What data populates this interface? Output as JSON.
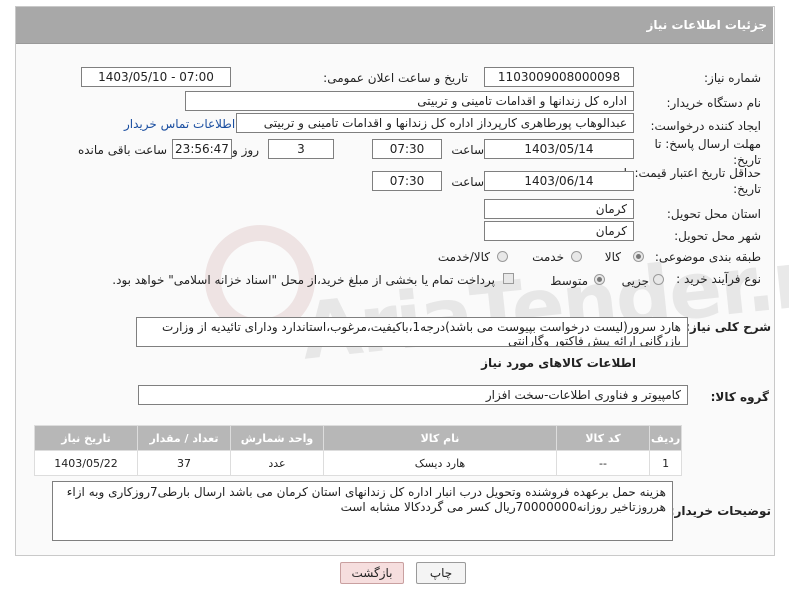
{
  "panel": {
    "title": "جزئیات اطلاعات نیاز"
  },
  "fields": {
    "need_number": {
      "label": "شماره نیاز:",
      "value": "1103009008000098"
    },
    "announce": {
      "label": "تاریخ و ساعت اعلان عمومی:",
      "value": "1403/05/10 - 07:00"
    },
    "buyer": {
      "label": "نام دستگاه خریدار:",
      "value": "اداره کل زندانها و اقدامات تامینی و تربیتی"
    },
    "requester": {
      "label": "ایجاد کننده درخواست:",
      "value": "عبدالوهاب پورطاهری کارپرداز اداره کل زندانها و اقدامات تامینی و تربیتی",
      "contact_link": "اطلاعات تماس خریدار"
    },
    "deadline": {
      "label": "مهلت ارسال پاسخ: تا تاریخ:",
      "date": "1403/05/14",
      "time_label": "ساعت",
      "time": "07:30",
      "days": "3",
      "days_label": "روز و",
      "remaining": "23:56:47",
      "remaining_label": "ساعت باقی مانده"
    },
    "validity": {
      "label": "حداقل تاریخ اعتبار قیمت: تا تاریخ:",
      "date": "1403/06/14",
      "time_label": "ساعت",
      "time": "07:30"
    },
    "province": {
      "label": "استان محل تحویل:",
      "value": "کرمان"
    },
    "city": {
      "label": "شهر محل تحویل:",
      "value": "کرمان"
    },
    "category": {
      "label": "طبقه بندی موضوعی:",
      "options": [
        "کالا",
        "خدمت",
        "کالا/خدمت"
      ]
    },
    "process": {
      "label": "نوع فرآیند خرید :",
      "options": [
        "جزیی",
        "متوسط"
      ],
      "treasury_note": "پرداخت تمام یا بخشی از مبلغ خرید،از محل \"اسناد خزانه اسلامی\" خواهد بود."
    }
  },
  "summary": {
    "label": "شرح کلی نیاز:",
    "text": "هارد سرور(لیست درخواست بپیوست می باشد)درجه1،باکیفیت،مرغوب،استاندارد ودارای تائیدیه از وزارت بازرگانی ارائه پیش فاکتور وگارانتی"
  },
  "goods_section": {
    "title": "اطلاعات کالاهای مورد نیاز",
    "group_label": "گروه کالا:",
    "group_value": "کامپیوتر و فناوری اطلاعات-سخت افزار"
  },
  "table": {
    "headers": [
      "ردیف",
      "کد کالا",
      "نام کالا",
      "واحد شمارش",
      "تعداد / مقدار",
      "تاریخ نیاز"
    ],
    "rows": [
      [
        "1",
        "--",
        "هارد دیسک",
        "عدد",
        "37",
        "1403/05/22"
      ]
    ]
  },
  "buyer_notes": {
    "label": "توضیحات خریدار:",
    "text": "هزینه حمل برعهده فروشنده وتحویل درب انبار اداره کل زندانهای استان کرمان می باشد ارسال بارطی7روزکاری وبه ازاء هرروزتاخیر روزانه70000000ریال کسر می گرددکالا مشابه است"
  },
  "buttons": {
    "print": "چاپ",
    "back": "بازگشت"
  },
  "watermark": "AriaTender.neT"
}
